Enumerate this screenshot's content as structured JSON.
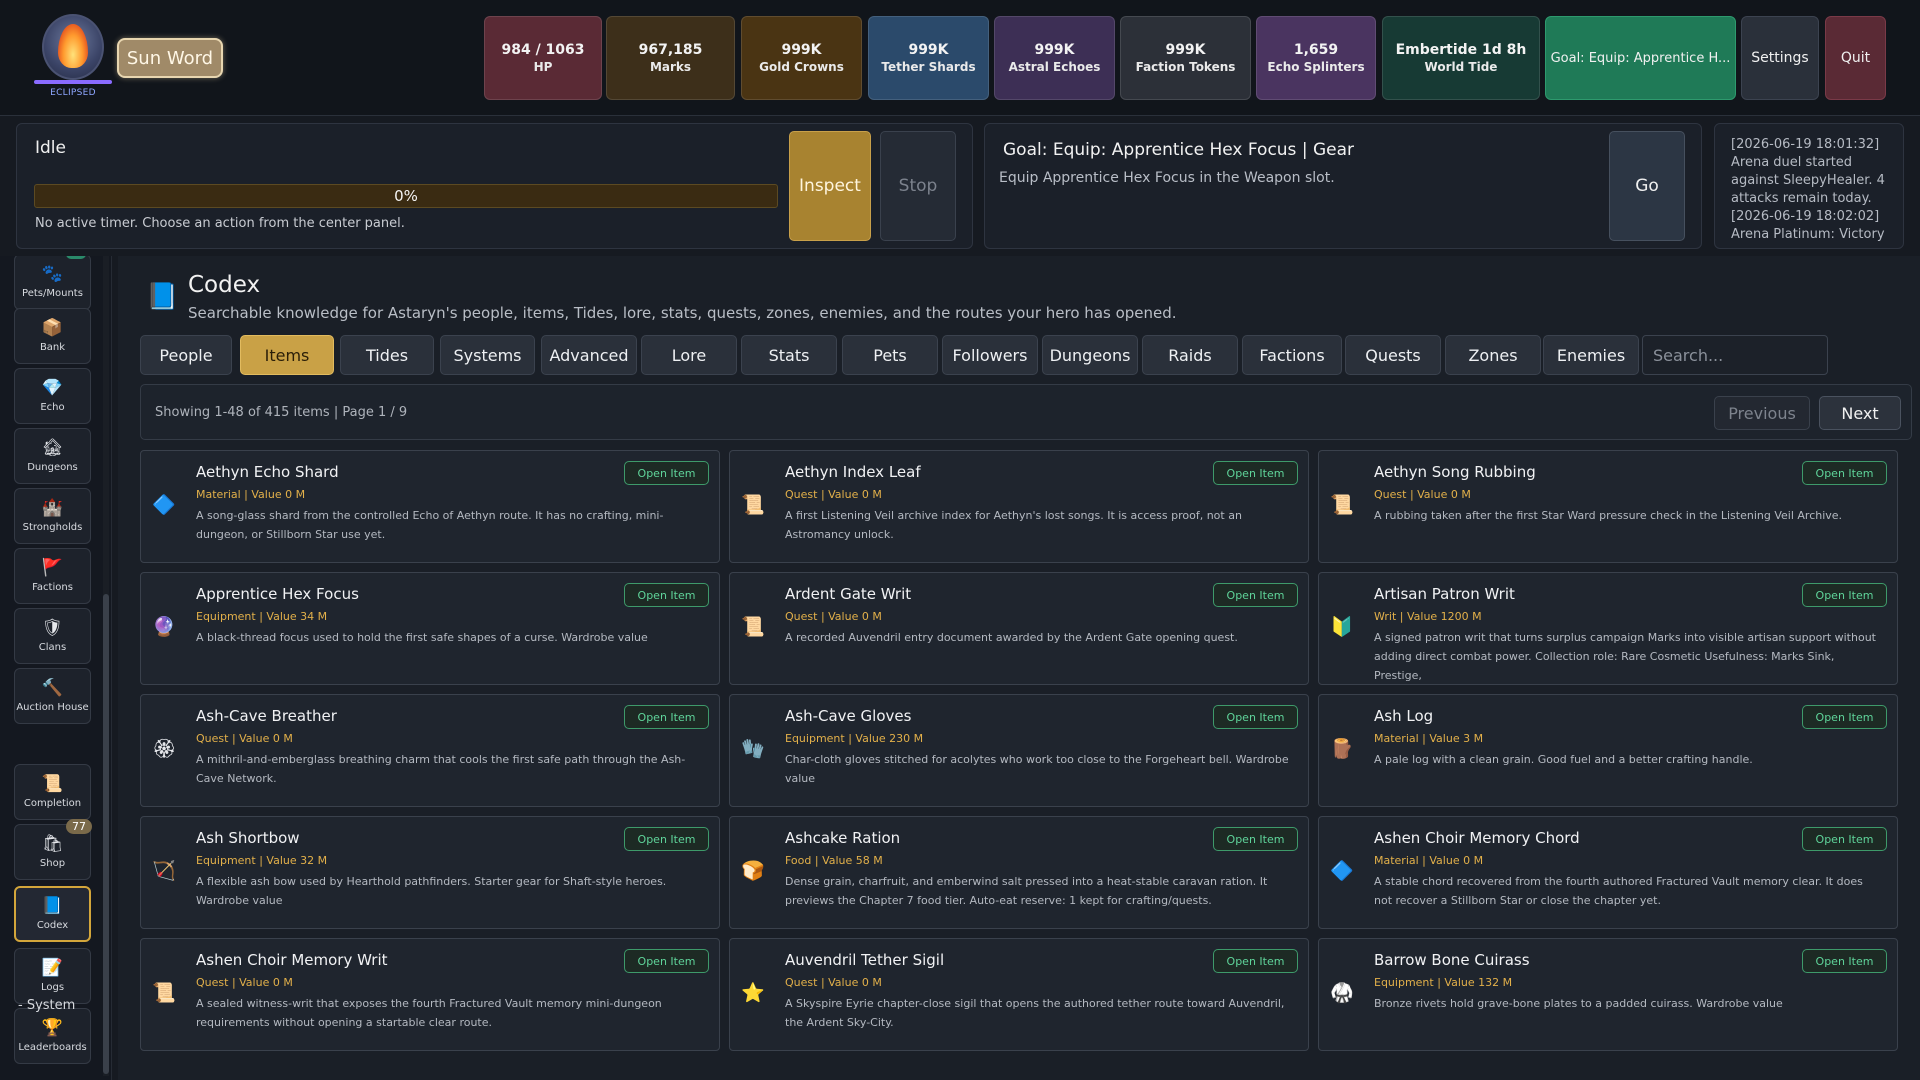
{
  "hero": {
    "sigil_label": "ECLIPSED",
    "word_button": "Sun Word"
  },
  "stats": [
    {
      "value": "984 / 1063",
      "label": "HP",
      "color": "#5a2a35"
    },
    {
      "value": "967,185",
      "label": "Marks",
      "color": "#3d2f1a"
    },
    {
      "value": "999K",
      "label": "Gold Crowns",
      "color": "#4a3413"
    },
    {
      "value": "999K",
      "label": "Tether Shards",
      "color": "#2b4a6b"
    },
    {
      "value": "999K",
      "label": "Astral Echoes",
      "color": "#3d2f55"
    },
    {
      "value": "999K",
      "label": "Faction Tokens",
      "color": "#2c3038"
    },
    {
      "value": "1,659",
      "label": "Echo Splinters",
      "color": "#4a3460"
    },
    {
      "value": "Embertide 1d 8h",
      "label": "World Tide",
      "color": "#173a34"
    }
  ],
  "top_buttons": {
    "goal": "Goal: Equip: Apprentice H...",
    "settings": "Settings",
    "quit": "Quit"
  },
  "activity": {
    "status": "Idle",
    "progress_text": "0%",
    "progress": 0,
    "note": "No active timer. Choose an action from the center panel.",
    "inspect": "Inspect",
    "stop": "Stop"
  },
  "goal_panel": {
    "title": "Goal: Equip: Apprentice Hex Focus | Gear",
    "description": "Equip Apprentice Hex Focus in the Weapon slot.",
    "go": "Go"
  },
  "log": {
    "text": "[2026-06-19 18:01:32] Arena duel started against SleepyHealer. 4 attacks remain today. [2026-06-19 18:02:02] Arena Platinum: Victory"
  },
  "sidebar": {
    "section_system": "- System",
    "items": [
      {
        "label": "Pets/Mounts",
        "icon": "paw-icon"
      },
      {
        "label": "Bank",
        "icon": "chest-icon"
      },
      {
        "label": "Echo",
        "icon": "crystal-icon"
      },
      {
        "label": "Dungeons",
        "icon": "dungeon-icon"
      },
      {
        "label": "Strongholds",
        "icon": "castle-icon"
      },
      {
        "label": "Factions",
        "icon": "banner-icon"
      },
      {
        "label": "Clans",
        "icon": "shield-icon"
      },
      {
        "label": "Auction House",
        "icon": "gavel-icon"
      },
      {
        "label": "Completion",
        "icon": "scroll-icon"
      },
      {
        "label": "Shop",
        "icon": "bag-icon",
        "badge": "77"
      },
      {
        "label": "Codex",
        "icon": "book-icon"
      },
      {
        "label": "Logs",
        "icon": "log-icon"
      },
      {
        "label": "Leaderboards",
        "icon": "trophy-icon"
      }
    ]
  },
  "codex": {
    "title": "Codex",
    "subtitle": "Searchable knowledge for Astaryn's people, items, Tides, lore, stats, quests, zones, enemies, and the routes your hero has opened.",
    "tabs": [
      "People",
      "Items",
      "Tides",
      "Systems",
      "Advanced",
      "Lore",
      "Stats",
      "Pets",
      "Followers",
      "Dungeons",
      "Raids",
      "Factions",
      "Quests",
      "Zones",
      "Enemies"
    ],
    "active_tab": "Items",
    "search_placeholder": "Search...",
    "pager_text": "Showing 1-48 of 415 items | Page 1 / 9",
    "previous": "Previous",
    "next": "Next",
    "open_label": "Open Item",
    "items": [
      {
        "name": "Aethyn Echo Shard",
        "meta": "Material | Value 0 M",
        "desc": "A song-glass shard from the controlled Echo of Aethyn route. It has no crafting, mini-dungeon, or Stillborn Star use yet.",
        "icon": "crystal-shard-icon"
      },
      {
        "name": "Aethyn Index Leaf",
        "meta": "Quest | Value 0 M",
        "desc": "A first Listening Veil archive index for Aethyn's lost songs. It is access proof, not an Astromancy unlock.",
        "icon": "quest-scroll-icon"
      },
      {
        "name": "Aethyn Song Rubbing",
        "meta": "Quest | Value 0 M",
        "desc": "A rubbing taken after the first Star Ward pressure check in the Listening Veil Archive.",
        "icon": "quest-scroll-icon"
      },
      {
        "name": "Apprentice Hex Focus",
        "meta": "Equipment | Value 34 M",
        "desc": "A black-thread focus used to hold the first safe shapes of a curse. Wardrobe value",
        "icon": "focus-icon"
      },
      {
        "name": "Ardent Gate Writ",
        "meta": "Quest | Value 0 M",
        "desc": "A recorded Auvendril entry document awarded by the Ardent Gate opening quest.",
        "icon": "quest-scroll-icon"
      },
      {
        "name": "Artisan Patron Writ",
        "meta": "Writ | Value 1200 M",
        "desc": "A signed patron writ that turns surplus campaign Marks into visible artisan support without adding direct combat power. Collection role: Rare Cosmetic Usefulness: Marks Sink, Prestige,",
        "icon": "writ-seal-icon"
      },
      {
        "name": "Ash-Cave Breather",
        "meta": "Quest | Value 0 M",
        "desc": "A mithril-and-emberglass breathing charm that cools the first safe path through the Ash-Cave Network.",
        "icon": "charm-icon"
      },
      {
        "name": "Ash-Cave Gloves",
        "meta": "Equipment | Value 230 M",
        "desc": "Char-cloth gloves stitched for acolytes who work too close to the Forgeheart bell. Wardrobe value",
        "icon": "gloves-icon"
      },
      {
        "name": "Ash Log",
        "meta": "Material | Value 3 M",
        "desc": "A pale log with a clean grain. Good fuel and a better crafting handle.",
        "icon": "log-material-icon"
      },
      {
        "name": "Ash Shortbow",
        "meta": "Equipment | Value 32 M",
        "desc": "A flexible ash bow used by Hearthold pathfinders. Starter gear for Shaft-style heroes. Wardrobe value",
        "icon": "bow-icon"
      },
      {
        "name": "Ashcake Ration",
        "meta": "Food | Value 58 M",
        "desc": "Dense grain, charfruit, and emberwind salt pressed into a heat-stable caravan ration. It previews the Chapter 7 food tier. Auto-eat reserve: 1 kept for crafting/quests.",
        "icon": "ration-icon"
      },
      {
        "name": "Ashen Choir Memory Chord",
        "meta": "Material | Value 0 M",
        "desc": "A stable chord recovered from the fourth authored Fractured Vault memory clear. It does not recover a Stillborn Star or close the chapter yet.",
        "icon": "crystal-shard-icon"
      },
      {
        "name": "Ashen Choir Memory Writ",
        "meta": "Quest | Value 0 M",
        "desc": "A sealed witness-writ that exposes the fourth Fractured Vault memory mini-dungeon requirements without opening a startable clear route.",
        "icon": "quest-scroll-icon"
      },
      {
        "name": "Auvendril Tether Sigil",
        "meta": "Quest | Value 0 M",
        "desc": "A Skyspire Eyrie chapter-close sigil that opens the authored tether route toward Auvendril, the Ardent Sky-City.",
        "icon": "sigil-icon"
      },
      {
        "name": "Barrow Bone Cuirass",
        "meta": "Equipment | Value 132 M",
        "desc": "Bronze rivets hold grave-bone plates to a padded cuirass. Wardrobe value",
        "icon": "cuirass-icon"
      }
    ]
  }
}
